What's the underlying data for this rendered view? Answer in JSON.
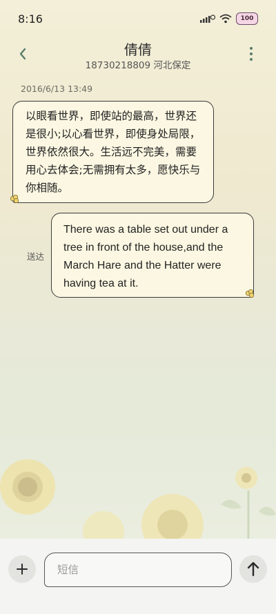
{
  "status_bar": {
    "time": "8:16",
    "battery": "100"
  },
  "header": {
    "contact_name": "倩倩",
    "contact_subtitle": "18730218809 河北保定"
  },
  "conversation": {
    "timestamp": "2016/6/13 13:49",
    "messages": [
      {
        "direction": "incoming",
        "text": "以眼看世界，即使站的最高，世界还是很小;以心看世界，即使身处局限，世界依然很大。生活远不完美，需要用心去体会;无需拥有太多，愿快乐与你相随。"
      },
      {
        "direction": "outgoing",
        "text": "There was a table set out under a tree in front of the house,and the March Hare and the Hatter were having tea at it.",
        "status": "送达"
      }
    ]
  },
  "composer": {
    "placeholder": "短信"
  },
  "icons": {
    "back": "chevron-left-icon",
    "more": "more-vertical-icon",
    "add": "plus-icon",
    "send": "arrow-up-icon"
  },
  "colors": {
    "accent": "#5a7d6a",
    "bubble": "#fbf7e2"
  }
}
